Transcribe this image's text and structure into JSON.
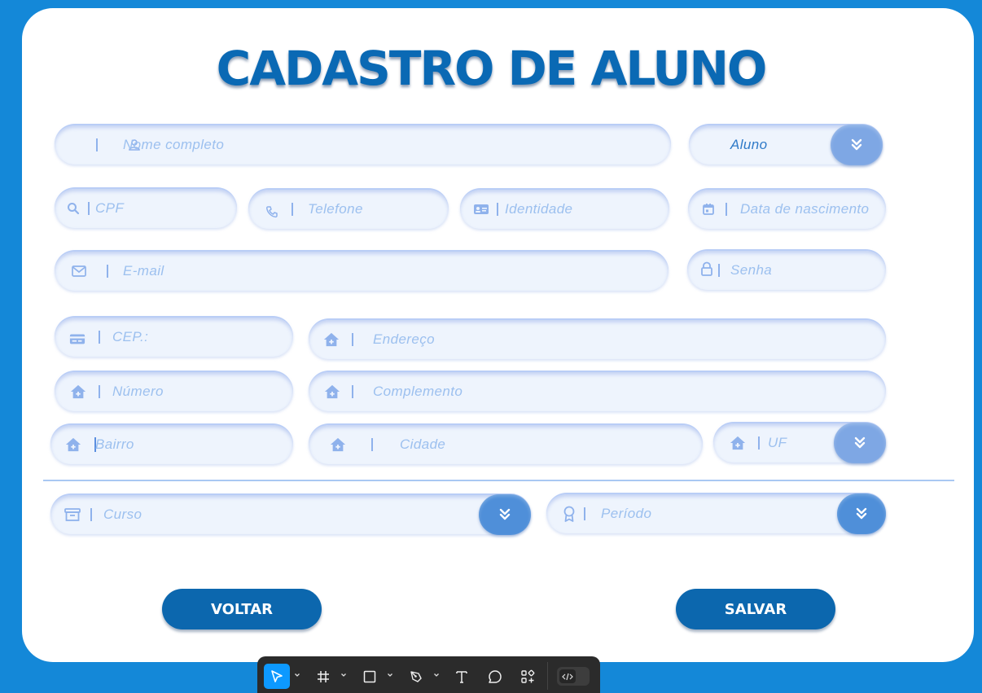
{
  "page": {
    "title": "CADASTRO DE ALUNO"
  },
  "form": {
    "nome": {
      "placeholder": "Nome completo",
      "icon": "user-icon"
    },
    "tipo": {
      "value": "Aluno",
      "icon": "double-chevron-down-icon"
    },
    "cpf": {
      "placeholder": "CPF",
      "icon": "search-icon"
    },
    "telefone": {
      "placeholder": "Telefone",
      "icon": "phone-icon"
    },
    "identidade": {
      "placeholder": "Identidade",
      "icon": "id-card-icon"
    },
    "nascimento": {
      "placeholder": "Data de nascimento",
      "icon": "calendar-icon"
    },
    "email": {
      "placeholder": "E-mail",
      "icon": "mail-icon"
    },
    "senha": {
      "placeholder": "Senha",
      "icon": "lock-icon"
    },
    "cep": {
      "placeholder": "CEP.:",
      "icon": "card-icon"
    },
    "endereco": {
      "placeholder": "Endereço",
      "icon": "home-icon"
    },
    "numero": {
      "placeholder": "Número",
      "icon": "home-icon"
    },
    "complemento": {
      "placeholder": "Complemento",
      "icon": "home-icon"
    },
    "bairro": {
      "placeholder": "Bairro",
      "icon": "home-icon"
    },
    "cidade": {
      "placeholder": "Cidade",
      "icon": "home-icon"
    },
    "uf": {
      "placeholder": "UF",
      "icon": "home-icon"
    },
    "curso": {
      "placeholder": "Curso",
      "icon": "archive-icon"
    },
    "periodo": {
      "placeholder": "Período",
      "icon": "award-icon"
    }
  },
  "buttons": {
    "voltar": "VOLTAR",
    "salvar": "SALVAR"
  },
  "toolbar": {
    "tools": [
      "move-tool",
      "frame-tool",
      "shape-tool",
      "pen-tool",
      "text-tool",
      "comment-tool",
      "components-tool",
      "dev-mode-toggle"
    ]
  },
  "colors": {
    "background": "#1488d8",
    "title": "#0a69b4",
    "button": "#0c67ae",
    "placeholder": "#9cc0ef",
    "dropdown": "#4f8fd9",
    "toolbar_accent": "#0d99ff"
  }
}
